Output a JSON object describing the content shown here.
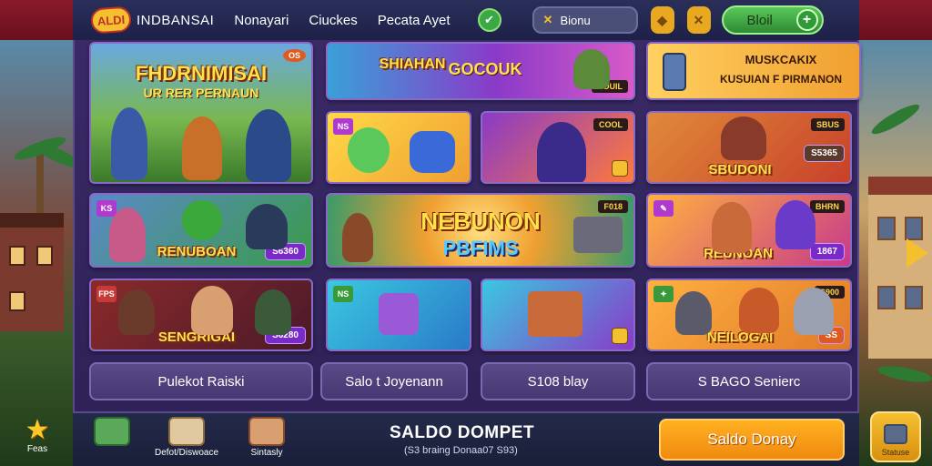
{
  "header": {
    "logo_text": "ALDI",
    "brand": "INDBANSAI",
    "nav": [
      "Nonayari",
      "Ciuckes",
      "Pecata Ayet"
    ],
    "search_label": "Bionu",
    "boost_label": "Bloil"
  },
  "cards": {
    "c1": {
      "title": "FHDRNIMISAI",
      "subtitle": "UR RER PERNAUN",
      "tag": "OS"
    },
    "c2": {
      "title": "SHIAHAN",
      "subtitle": "GOCOUK",
      "tag": "BOUIL"
    },
    "c3": {
      "title": "MUSKCAKIX",
      "subtitle": "KUSUIAN F PIRMANON"
    },
    "c4": {
      "badge": "NS"
    },
    "c5": {
      "tag": "COOL"
    },
    "c6": {
      "title": "SBUDONI",
      "tag": "SBUS",
      "price": "S5365"
    },
    "c7": {
      "title": "RENUBOAN",
      "badge": "KS",
      "price": "S6360"
    },
    "c8": {
      "title": "NEBUNON",
      "subtitle": "PBFIMS",
      "tag": "F018"
    },
    "c9": {
      "title": "REUNOAN",
      "tag": "BHRN",
      "price": "1867"
    },
    "c10": {
      "title": "SENGRIGAI",
      "badge": "FPS",
      "price": "S6280"
    },
    "c11": {
      "badge": "NS"
    },
    "c12": {
      "title": "NEILOGAI",
      "tag": "S900",
      "price": "SS"
    }
  },
  "buttons": [
    "Pulekot Raiski",
    "Salo t Joyenann",
    "S108 blay",
    "S BAGO Senierc"
  ],
  "bottom": {
    "fav_label": "Feas",
    "item1_label": "",
    "item2_label": "Defot/Diswoace",
    "item3_label": "Sintasly",
    "saldo_title": "SALDO DOMPET",
    "saldo_sub": "(S3 braing Donaa07 S93)",
    "saldo_button": "Saldo Donay",
    "status_label": "Statuse"
  }
}
